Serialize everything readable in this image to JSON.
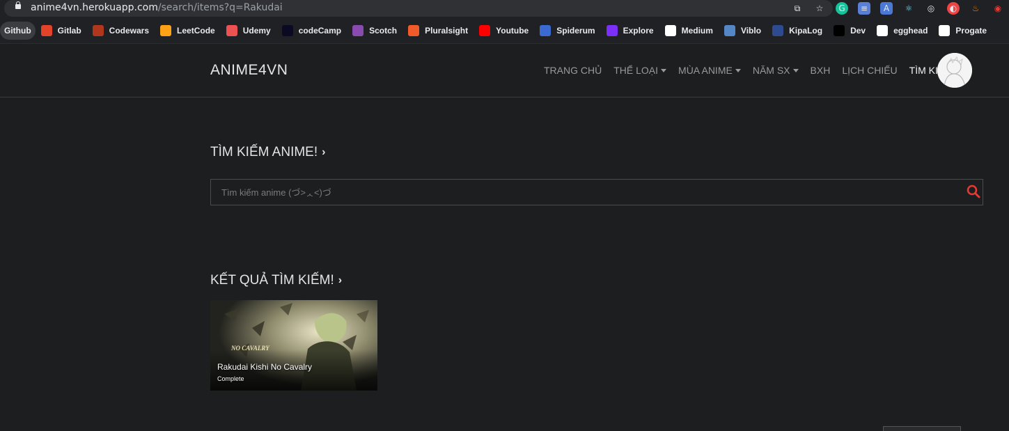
{
  "browser": {
    "url_host": "anime4vn.herokuapp.com",
    "url_path": "/search/items?q=Rakudai",
    "bookmarks": [
      {
        "label": "Github",
        "icon": "github-icon",
        "color": "#3c3d40"
      },
      {
        "label": "Gitlab",
        "icon": "gitlab-icon",
        "color": "#e24329"
      },
      {
        "label": "Codewars",
        "icon": "codewars-icon",
        "color": "#b1361e"
      },
      {
        "label": "LeetCode",
        "icon": "leetcode-icon",
        "color": "#ffa116"
      },
      {
        "label": "Udemy",
        "icon": "udemy-icon",
        "color": "#ec5252"
      },
      {
        "label": "codeCamp",
        "icon": "freecodecamp-icon",
        "color": "#0a0a23"
      },
      {
        "label": "Scotch",
        "icon": "scotch-icon",
        "color": "#8a4baf"
      },
      {
        "label": "Pluralsight",
        "icon": "pluralsight-icon",
        "color": "#f15b2a"
      },
      {
        "label": "Youtube",
        "icon": "youtube-icon",
        "color": "#ff0000"
      },
      {
        "label": "Spiderum",
        "icon": "spiderum-icon",
        "color": "#3b6ad3"
      },
      {
        "label": "Explore",
        "icon": "explore-icon",
        "color": "#7b2ff7"
      },
      {
        "label": "Medium",
        "icon": "medium-icon",
        "color": "#ffffff"
      },
      {
        "label": "Viblo",
        "icon": "viblo-icon",
        "color": "#5387c6"
      },
      {
        "label": "KipaLog",
        "icon": "kipalog-icon",
        "color": "#2f4b8f"
      },
      {
        "label": "Dev",
        "icon": "dev-icon",
        "color": "#000000"
      },
      {
        "label": "egghead",
        "icon": "egghead-icon",
        "color": "#ffffff"
      },
      {
        "label": "Progate",
        "icon": "progate-icon",
        "color": "#ffffff"
      }
    ]
  },
  "header": {
    "brand": "ANIME4VN",
    "nav": [
      {
        "label": "TRANG CHỦ",
        "dropdown": false,
        "active": false
      },
      {
        "label": "THỂ LOẠI",
        "dropdown": true,
        "active": false
      },
      {
        "label": "MÙA ANIME",
        "dropdown": true,
        "active": false
      },
      {
        "label": "NĂM SX",
        "dropdown": true,
        "active": false
      },
      {
        "label": "BXH",
        "dropdown": false,
        "active": false
      },
      {
        "label": "LỊCH CHIẾU",
        "dropdown": false,
        "active": false
      },
      {
        "label": "TÌM KIẾM",
        "dropdown": false,
        "active": true
      }
    ]
  },
  "search": {
    "title": "TÌM KIẾM ANIME!",
    "placeholder": "Tìm kiếm anime (づ˃ᆺ˂)づ",
    "value": ""
  },
  "results": {
    "title": "KẾT QUẢ TÌM KIẾM!",
    "items": [
      {
        "title": "Rakudai Kishi No Cavalry",
        "status": "Complete"
      }
    ]
  },
  "colors": {
    "background": "#1c1e1f",
    "search_icon": "#e53935"
  }
}
